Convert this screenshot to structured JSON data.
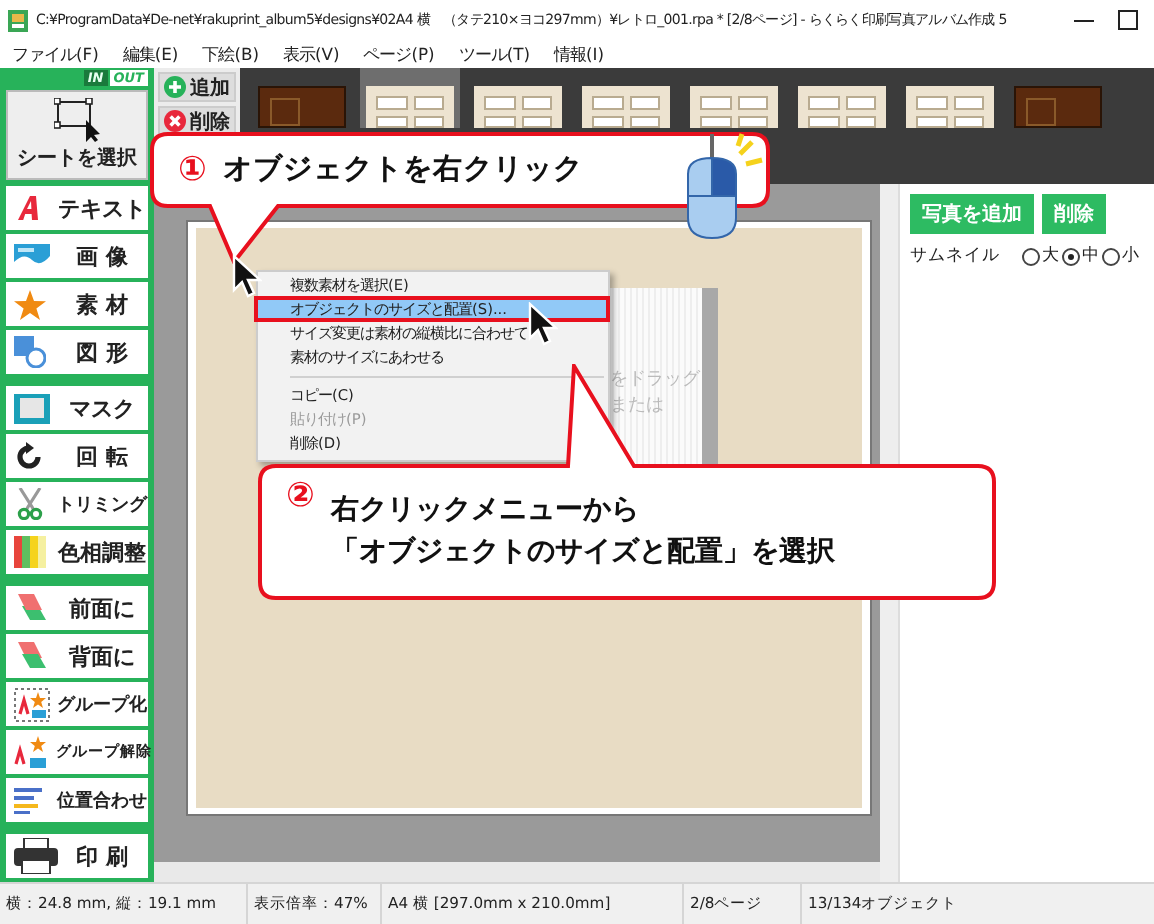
{
  "window": {
    "title": "C:¥ProgramData¥De-net¥rakuprint_album5¥designs¥02A4 横　（タテ210×ヨコ297mm）¥レトロ_001.rpa * [2/8ページ] - らくらく印刷写真アルバム作成 5"
  },
  "menu": [
    "ファイル(F)",
    "編集(E)",
    "下絵(B)",
    "表示(V)",
    "ページ(P)",
    "ツール(T)",
    "情報(I)"
  ],
  "sidebar": {
    "io_toggle": [
      {
        "label": "IN",
        "selected": false
      },
      {
        "label": "OUT",
        "selected": true
      }
    ],
    "select_sheet": "シートを選択",
    "groups": [
      [
        {
          "label": "テキスト",
          "kind": "text"
        },
        {
          "label": "画 像",
          "kind": "image"
        },
        {
          "label": "素 材",
          "kind": "star"
        },
        {
          "label": "図 形",
          "kind": "shape"
        }
      ],
      [
        {
          "label": "マスク",
          "kind": "mask"
        },
        {
          "label": "回 転",
          "kind": "rotate"
        },
        {
          "label": "トリミング",
          "kind": "trim"
        },
        {
          "label": "色相調整",
          "kind": "hue"
        }
      ],
      [
        {
          "label": "前面に",
          "kind": "front"
        },
        {
          "label": "背面に",
          "kind": "back"
        },
        {
          "label": "グループ化",
          "kind": "group"
        },
        {
          "label": "グループ解除",
          "kind": "ungroup"
        },
        {
          "label": "位置合わせ",
          "kind": "align"
        }
      ],
      [
        {
          "label": "印 刷",
          "kind": "print"
        }
      ]
    ]
  },
  "page_buttons": [
    {
      "label": "追加",
      "kind": "add"
    },
    {
      "label": "削除",
      "kind": "delete"
    }
  ],
  "thumbnails": [
    {
      "kind": "dark",
      "selected": false
    },
    {
      "kind": "light",
      "selected": true
    },
    {
      "kind": "light",
      "selected": false
    },
    {
      "kind": "light",
      "selected": false
    },
    {
      "kind": "light",
      "selected": false
    },
    {
      "kind": "light",
      "selected": false
    },
    {
      "kind": "light",
      "selected": false
    },
    {
      "kind": "dark",
      "selected": false
    }
  ],
  "frame_placeholder": [
    "をドラッグ",
    "または"
  ],
  "context_menu": [
    {
      "kind": "item",
      "label": "複数素材を選択(E)",
      "highlighted": false,
      "disabled": false
    },
    {
      "kind": "item",
      "label": "オブジェクトのサイズと配置(S)...",
      "highlighted": true,
      "disabled": false
    },
    {
      "kind": "item",
      "label": "サイズ変更は素材の縦横比に合わせて",
      "highlighted": false,
      "disabled": false
    },
    {
      "kind": "item",
      "label": "素材のサイズにあわせる",
      "highlighted": false,
      "disabled": false
    },
    {
      "kind": "separator"
    },
    {
      "kind": "item",
      "label": "コピー(C)",
      "highlighted": false,
      "disabled": false
    },
    {
      "kind": "item",
      "label": "貼り付け(P)",
      "highlighted": false,
      "disabled": true
    },
    {
      "kind": "item",
      "label": "削除(D)",
      "highlighted": false,
      "disabled": false
    }
  ],
  "right_panel": {
    "buttons": [
      "写真を追加",
      "削除"
    ],
    "thumbnail_label": "サムネイル",
    "sizes": [
      {
        "label": "大",
        "selected": false
      },
      {
        "label": "中",
        "selected": true
      },
      {
        "label": "小",
        "selected": false
      }
    ]
  },
  "callouts": [
    {
      "number": "①",
      "lines": [
        "オブジェクトを右クリック"
      ]
    },
    {
      "number": "②",
      "lines": [
        "右クリックメニューから",
        "「オブジェクトのサイズと配置」を選択"
      ]
    }
  ],
  "status_bar": [
    "横：24.8 mm, 縦：19.1 mm",
    "表示倍率：47%",
    "A4 横 [297.0mm x 210.0mm]",
    "2/8ページ",
    "13/134オブジェクト"
  ]
}
